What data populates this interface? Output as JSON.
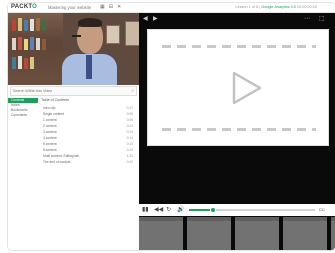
{
  "app": {
    "logo_text_a": "PACKT",
    "logo_text_b": "O",
    "title": "Mastering your website"
  },
  "topbar_right": {
    "text": "Lesson 1 of 8 | ",
    "highlight": "Google Analytics 4.0",
    "extra": " 00:00:00:00"
  },
  "search": {
    "placeholder": "Search Within this Video",
    "icon": "search-icon"
  },
  "nav": {
    "items": [
      "Contents",
      "Notes",
      "Bookmarks",
      "Comments"
    ],
    "active_index": 0
  },
  "toc": {
    "title": "Table of Contents",
    "items": [
      {
        "title": "Intro clip",
        "duration": "0:17"
      },
      {
        "title": "Single content",
        "duration": "0:09"
      },
      {
        "title": "1 content",
        "duration": "0:05"
      },
      {
        "title": "2 content",
        "duration": "0:21"
      },
      {
        "title": "3 content",
        "duration": "0:19"
      },
      {
        "title": "4 content",
        "duration": "0:14"
      },
      {
        "title": "5 content",
        "duration": "0:20"
      },
      {
        "title": "6 content",
        "duration": "0:10"
      },
      {
        "title": "Multi content, Editing tab",
        "duration": "1:31"
      },
      {
        "title": "The end of module",
        "duration": "0:20"
      }
    ]
  },
  "player": {
    "top_controls": [
      "◀",
      "▶",
      "⋯",
      "⬚"
    ],
    "play_icon": "play-icon",
    "progress": 0.19
  },
  "controls": {
    "buttons": [
      "▮▮",
      "◀◀",
      "↻",
      "🔊"
    ],
    "cc": "CC"
  },
  "thumbs": {
    "count": 4
  },
  "colors": {
    "accent": "#1ea05a",
    "player_bg": "#0a0a0a",
    "thumb": "#727272"
  }
}
